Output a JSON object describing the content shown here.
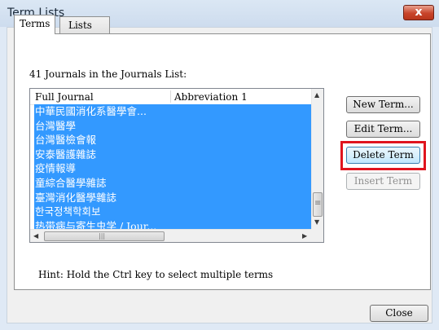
{
  "window": {
    "title": "Term Lists",
    "close_glyph": "x"
  },
  "tabs": [
    {
      "label": "Terms",
      "active": true
    },
    {
      "label": "Lists",
      "active": false
    }
  ],
  "list": {
    "count_label": "41 Journals in the Journals List:",
    "columns": [
      "Full Journal",
      "Abbreviation 1"
    ],
    "rows": [
      "中華民國消化系醫學會...",
      "台灣醫學",
      "台灣醫檢會報",
      "安泰醫護雜誌",
      "疫情報導",
      "童綜合醫學雜誌",
      "臺灣消化醫學雜誌",
      "한국정책학회보",
      "热带病与寄生虫学 / Jour..."
    ],
    "selection_color": "#3399ff"
  },
  "buttons": {
    "new_term": "New Term...",
    "edit_term": "Edit Term...",
    "delete_term": "Delete Term",
    "insert_term": "Insert Term",
    "close": "Close"
  },
  "hint": "Hint: Hold the Ctrl key to select multiple terms",
  "icons": {
    "scroll_up": "▲",
    "scroll_down": "▼",
    "scroll_left": "◀",
    "scroll_right": "▶",
    "grip": "≡",
    "hgrip": "|||"
  },
  "colors": {
    "highlight_box": "#e0141e"
  }
}
